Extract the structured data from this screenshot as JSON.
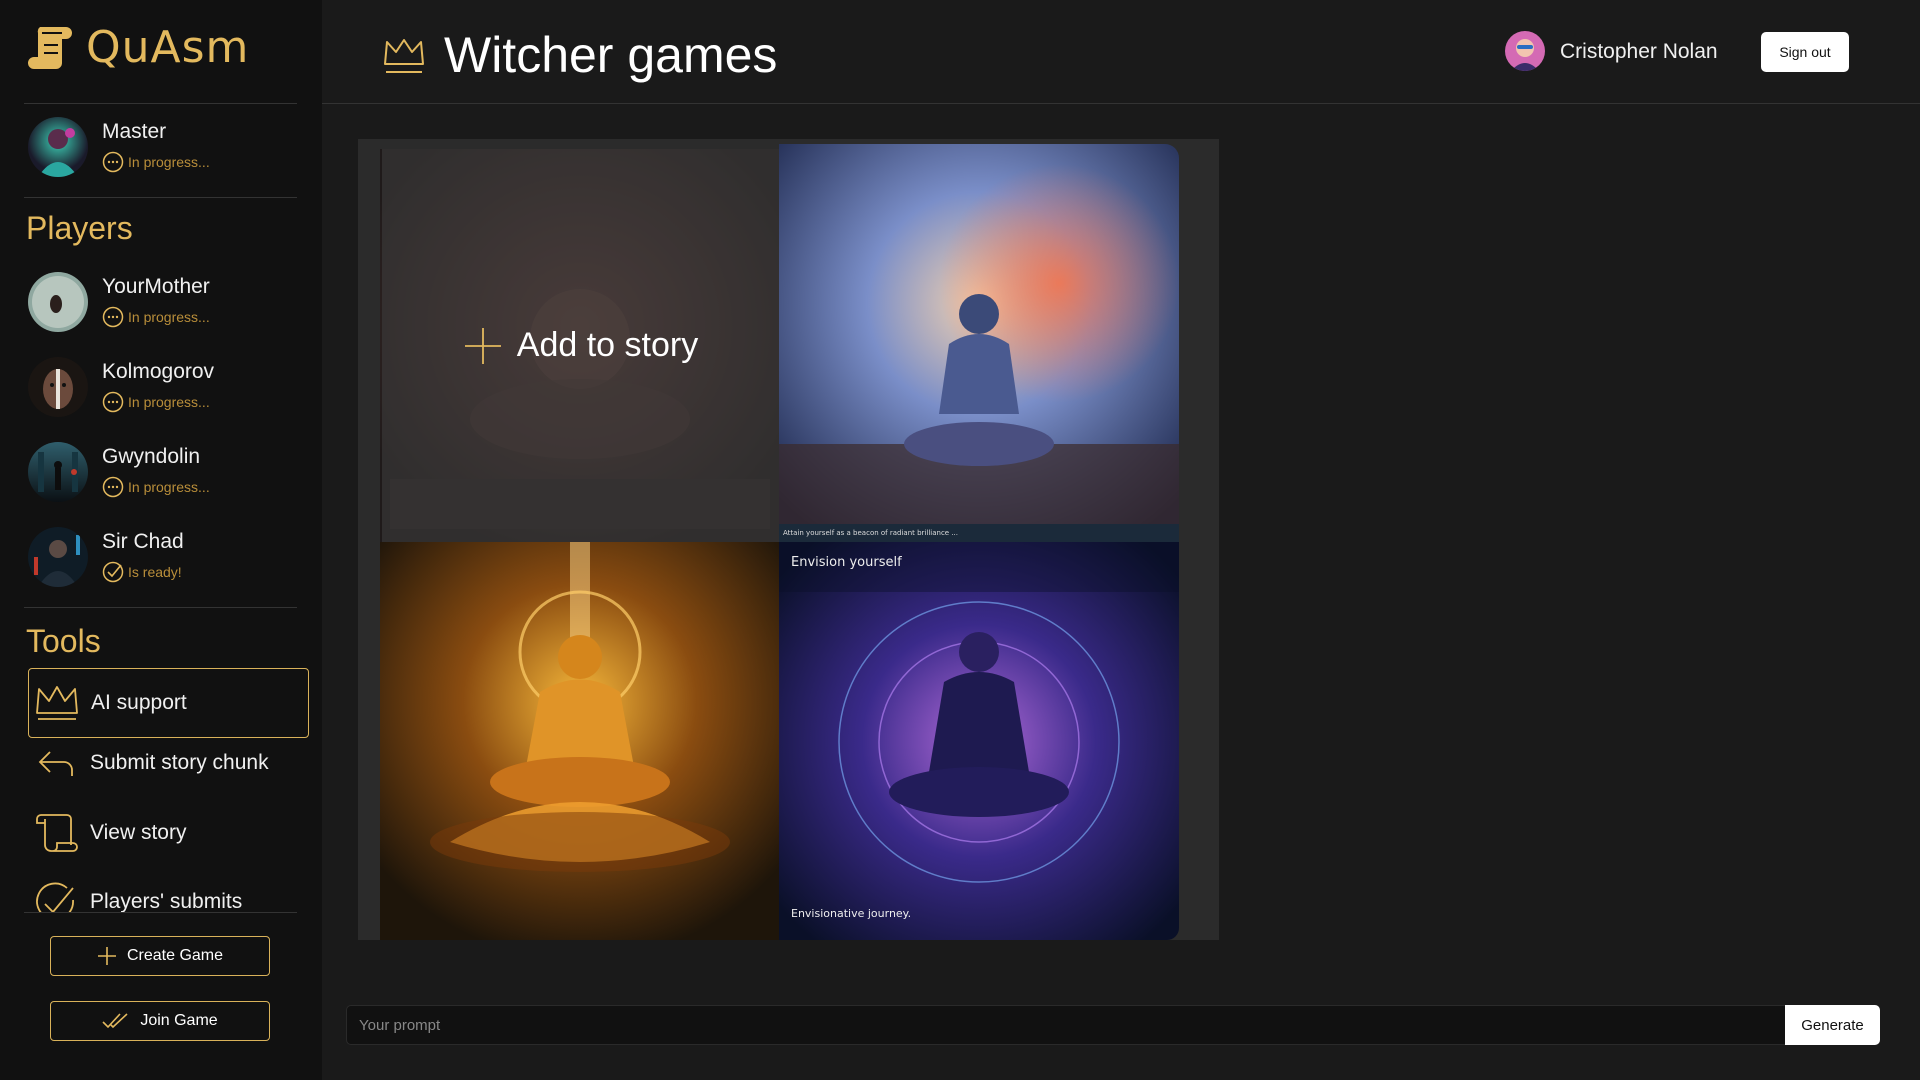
{
  "app": {
    "name": "QuAsm"
  },
  "header": {
    "game_title": "Witcher games",
    "user_name": "Cristopher Nolan",
    "signout_label": "Sign out"
  },
  "master": {
    "name": "Master",
    "status": "In progress..."
  },
  "players_section": {
    "title": "Players"
  },
  "players": [
    {
      "name": "YourMother",
      "status": "In progress...",
      "state": "progress"
    },
    {
      "name": "Kolmogorov",
      "status": "In progress...",
      "state": "progress"
    },
    {
      "name": "Gwyndolin",
      "status": "In progress...",
      "state": "progress"
    },
    {
      "name": "Sir Chad",
      "status": "Is ready!",
      "state": "ready"
    }
  ],
  "tools_section": {
    "title": "Tools"
  },
  "tools": [
    {
      "label": "AI support",
      "icon": "crown-icon",
      "active": true
    },
    {
      "label": "Submit story chunk",
      "icon": "reply-arrow-icon",
      "active": false
    },
    {
      "label": "View story",
      "icon": "scroll-icon",
      "active": false
    },
    {
      "label": "Players' submits",
      "icon": "check-circle-icon",
      "active": false
    }
  ],
  "actions": {
    "create_label": "Create Game",
    "join_label": "Join Game"
  },
  "gallery": {
    "add_label": "Add to story",
    "captions": {
      "img4_title": "Envision yourself",
      "img4_footer": "Envisionative journey."
    }
  },
  "prompt": {
    "placeholder": "Your prompt",
    "generate_label": "Generate"
  },
  "colors": {
    "accent": "#e3b95e",
    "background": "#1a1a1a",
    "sidebar": "#111111"
  }
}
